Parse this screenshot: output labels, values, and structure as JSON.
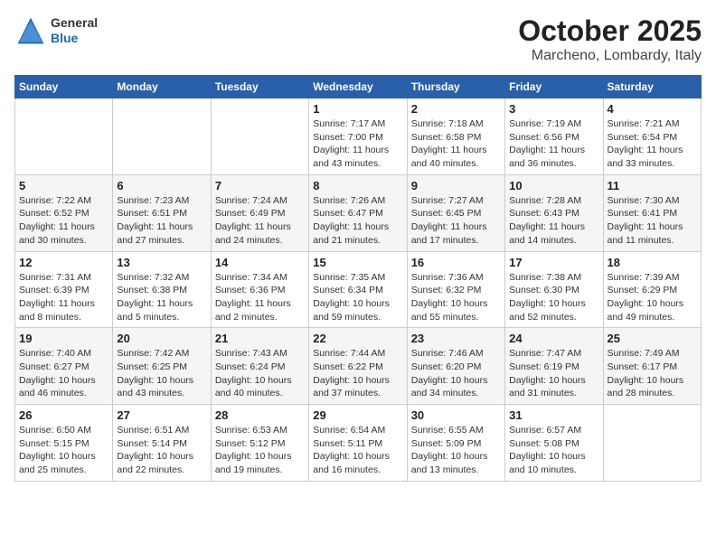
{
  "logo": {
    "general": "General",
    "blue": "Blue"
  },
  "header": {
    "month": "October 2025",
    "location": "Marcheno, Lombardy, Italy"
  },
  "weekdays": [
    "Sunday",
    "Monday",
    "Tuesday",
    "Wednesday",
    "Thursday",
    "Friday",
    "Saturday"
  ],
  "weeks": [
    [
      {
        "day": "",
        "info": ""
      },
      {
        "day": "",
        "info": ""
      },
      {
        "day": "",
        "info": ""
      },
      {
        "day": "1",
        "info": "Sunrise: 7:17 AM\nSunset: 7:00 PM\nDaylight: 11 hours and 43 minutes."
      },
      {
        "day": "2",
        "info": "Sunrise: 7:18 AM\nSunset: 6:58 PM\nDaylight: 11 hours and 40 minutes."
      },
      {
        "day": "3",
        "info": "Sunrise: 7:19 AM\nSunset: 6:56 PM\nDaylight: 11 hours and 36 minutes."
      },
      {
        "day": "4",
        "info": "Sunrise: 7:21 AM\nSunset: 6:54 PM\nDaylight: 11 hours and 33 minutes."
      }
    ],
    [
      {
        "day": "5",
        "info": "Sunrise: 7:22 AM\nSunset: 6:52 PM\nDaylight: 11 hours and 30 minutes."
      },
      {
        "day": "6",
        "info": "Sunrise: 7:23 AM\nSunset: 6:51 PM\nDaylight: 11 hours and 27 minutes."
      },
      {
        "day": "7",
        "info": "Sunrise: 7:24 AM\nSunset: 6:49 PM\nDaylight: 11 hours and 24 minutes."
      },
      {
        "day": "8",
        "info": "Sunrise: 7:26 AM\nSunset: 6:47 PM\nDaylight: 11 hours and 21 minutes."
      },
      {
        "day": "9",
        "info": "Sunrise: 7:27 AM\nSunset: 6:45 PM\nDaylight: 11 hours and 17 minutes."
      },
      {
        "day": "10",
        "info": "Sunrise: 7:28 AM\nSunset: 6:43 PM\nDaylight: 11 hours and 14 minutes."
      },
      {
        "day": "11",
        "info": "Sunrise: 7:30 AM\nSunset: 6:41 PM\nDaylight: 11 hours and 11 minutes."
      }
    ],
    [
      {
        "day": "12",
        "info": "Sunrise: 7:31 AM\nSunset: 6:39 PM\nDaylight: 11 hours and 8 minutes."
      },
      {
        "day": "13",
        "info": "Sunrise: 7:32 AM\nSunset: 6:38 PM\nDaylight: 11 hours and 5 minutes."
      },
      {
        "day": "14",
        "info": "Sunrise: 7:34 AM\nSunset: 6:36 PM\nDaylight: 11 hours and 2 minutes."
      },
      {
        "day": "15",
        "info": "Sunrise: 7:35 AM\nSunset: 6:34 PM\nDaylight: 10 hours and 59 minutes."
      },
      {
        "day": "16",
        "info": "Sunrise: 7:36 AM\nSunset: 6:32 PM\nDaylight: 10 hours and 55 minutes."
      },
      {
        "day": "17",
        "info": "Sunrise: 7:38 AM\nSunset: 6:30 PM\nDaylight: 10 hours and 52 minutes."
      },
      {
        "day": "18",
        "info": "Sunrise: 7:39 AM\nSunset: 6:29 PM\nDaylight: 10 hours and 49 minutes."
      }
    ],
    [
      {
        "day": "19",
        "info": "Sunrise: 7:40 AM\nSunset: 6:27 PM\nDaylight: 10 hours and 46 minutes."
      },
      {
        "day": "20",
        "info": "Sunrise: 7:42 AM\nSunset: 6:25 PM\nDaylight: 10 hours and 43 minutes."
      },
      {
        "day": "21",
        "info": "Sunrise: 7:43 AM\nSunset: 6:24 PM\nDaylight: 10 hours and 40 minutes."
      },
      {
        "day": "22",
        "info": "Sunrise: 7:44 AM\nSunset: 6:22 PM\nDaylight: 10 hours and 37 minutes."
      },
      {
        "day": "23",
        "info": "Sunrise: 7:46 AM\nSunset: 6:20 PM\nDaylight: 10 hours and 34 minutes."
      },
      {
        "day": "24",
        "info": "Sunrise: 7:47 AM\nSunset: 6:19 PM\nDaylight: 10 hours and 31 minutes."
      },
      {
        "day": "25",
        "info": "Sunrise: 7:49 AM\nSunset: 6:17 PM\nDaylight: 10 hours and 28 minutes."
      }
    ],
    [
      {
        "day": "26",
        "info": "Sunrise: 6:50 AM\nSunset: 5:15 PM\nDaylight: 10 hours and 25 minutes."
      },
      {
        "day": "27",
        "info": "Sunrise: 6:51 AM\nSunset: 5:14 PM\nDaylight: 10 hours and 22 minutes."
      },
      {
        "day": "28",
        "info": "Sunrise: 6:53 AM\nSunset: 5:12 PM\nDaylight: 10 hours and 19 minutes."
      },
      {
        "day": "29",
        "info": "Sunrise: 6:54 AM\nSunset: 5:11 PM\nDaylight: 10 hours and 16 minutes."
      },
      {
        "day": "30",
        "info": "Sunrise: 6:55 AM\nSunset: 5:09 PM\nDaylight: 10 hours and 13 minutes."
      },
      {
        "day": "31",
        "info": "Sunrise: 6:57 AM\nSunset: 5:08 PM\nDaylight: 10 hours and 10 minutes."
      },
      {
        "day": "",
        "info": ""
      }
    ]
  ]
}
